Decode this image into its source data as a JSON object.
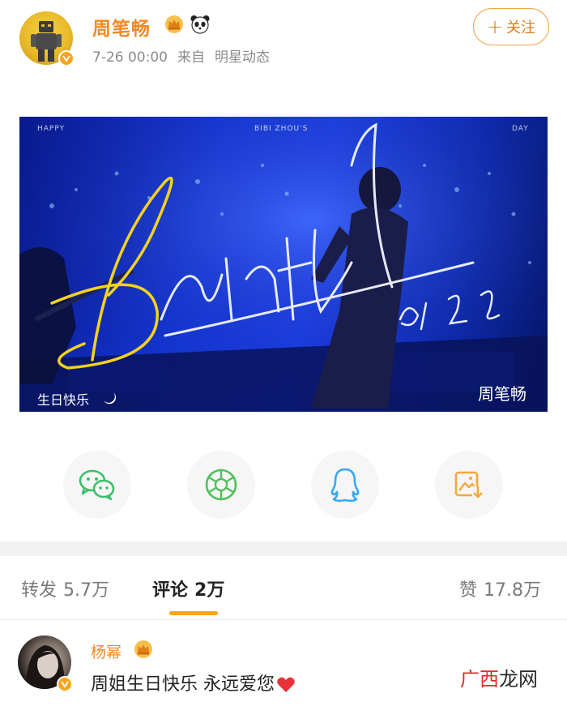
{
  "post": {
    "author_name": "周笔畅",
    "time": "7-26 00:00",
    "source_prefix": "来自",
    "source": "明星动态",
    "follow_label": "关注",
    "badges": [
      "crown-icon",
      "panda-icon"
    ]
  },
  "banner": {
    "top_left": "HAPPY",
    "top_center": "BIBI ZHOU'S",
    "top_right": "DAY",
    "script_word": "Birthday",
    "date_script": "07'26",
    "bottom_left": "生日快乐",
    "bottom_right": "周笔畅"
  },
  "share": [
    {
      "icon": "wechat-icon",
      "color": "#3cbf6a"
    },
    {
      "icon": "moments-icon",
      "color": "#4fc05a"
    },
    {
      "icon": "qq-icon",
      "color": "#39a8f0"
    },
    {
      "icon": "save-image-icon",
      "color": "#f2a93b"
    }
  ],
  "tabs": [
    {
      "label": "转发",
      "count": "5.7万"
    },
    {
      "label": "评论",
      "count": "2万"
    },
    {
      "label": "赞",
      "count": "17.8万"
    }
  ],
  "comment": {
    "user": "杨幂",
    "text": "周姐生日快乐 永远爱您"
  },
  "watermark": {
    "part1": "广西",
    "part2": "龙网"
  },
  "colors": {
    "accent_orange": "#f08a24",
    "tab_underline": "#f5a623",
    "banner_blue": "#1437d8"
  }
}
